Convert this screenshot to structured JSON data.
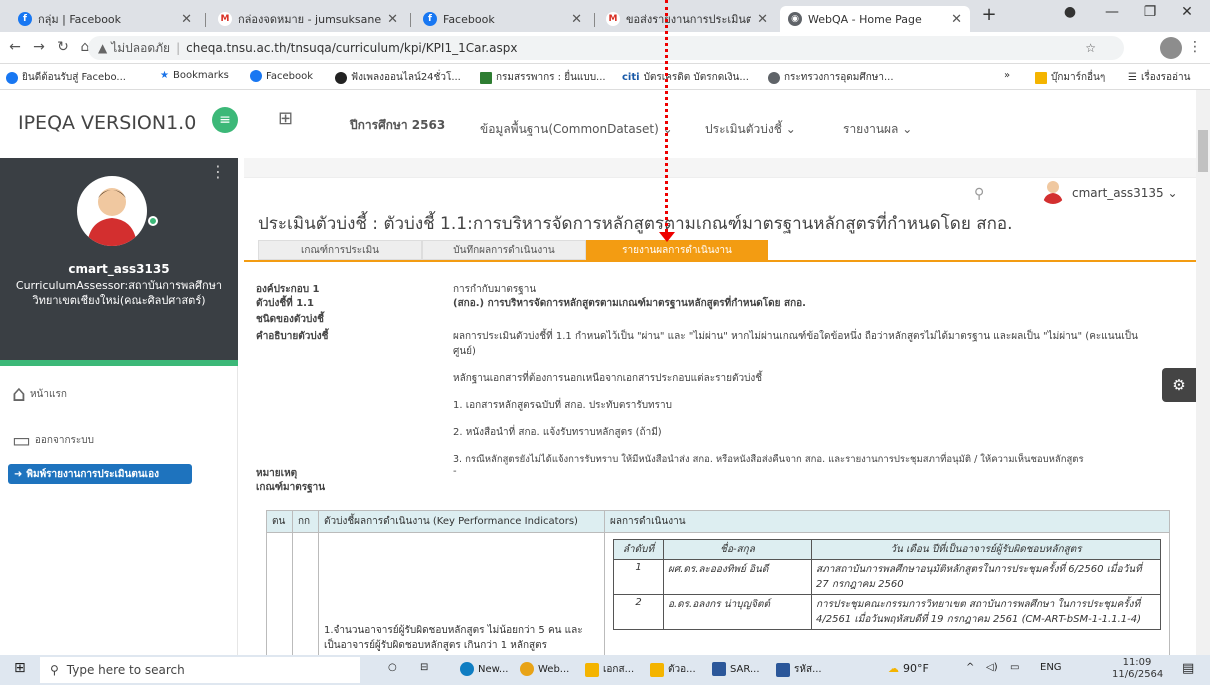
{
  "browser": {
    "tabs": [
      {
        "label": "กลุ่ม | Facebook",
        "icon": "facebook-icon",
        "color": "#1877f2"
      },
      {
        "label": "กล่องจดหมาย - jumsuksane",
        "icon": "gmail-icon",
        "color": "#d93025"
      },
      {
        "label": "Facebook",
        "icon": "facebook-icon",
        "color": "#1877f2"
      },
      {
        "label": "ขอส่งรายงานการประเมินตนเอง",
        "icon": "gmail-icon",
        "color": "#d93025"
      },
      {
        "label": "WebQA - Home Page",
        "icon": "globe-icon",
        "color": "#5f6368"
      }
    ],
    "new_tab": "+",
    "url_warning": "ไม่ปลอดภัย",
    "url": "cheqa.tnsu.ac.th/tnsuqa/curriculum/kpi/KPI1_1Car.aspx",
    "bookmarks": [
      "ยินดีต้อนรับสู่ Facebo...",
      "Bookmarks",
      "Facebook",
      "ฟังเพลงออนไลน์24ชั่วโ...",
      "กรมสรรพากร : ยื่นแบบ...",
      "บัตรเครดิต บัตรกดเงิน...",
      "กระทรวงการอุดมศึกษา..."
    ],
    "bookmark_more": "»",
    "bookmark_others": "บุ๊กมาร์กอื่นๆ",
    "reading_list": "เรื่องรออ่าน"
  },
  "topnav": {
    "brand": "IPEQA VERSION1.0",
    "year": "ปีการศึกษา 2563",
    "menu": [
      "ข้อมูลพื้นฐาน(CommonDataset)",
      "ประเมินตัวบ่งชี้",
      "รายงานผล"
    ]
  },
  "user": {
    "name": "cmart_ass3135",
    "role": "CurriculumAssessor:สถาบันการพลศึกษา วิทยาเขตเชียงใหม่(คณะศิลปศาสตร์)",
    "top_name": "cmart_ass3135"
  },
  "sidebar": {
    "home": "หน้าแรก",
    "logout": "ออกจากระบบ",
    "print": "พิมพ์รายงานการประเมินตนเอง"
  },
  "main": {
    "title": "ประเมินตัวบ่งชี้ : ตัวบ่งชี้ 1.1:การบริหารจัดการหลักสูตรตามเกณฑ์มาตรฐานหลักสูตรที่กำหนดโดย สกอ.",
    "tabs": [
      "เกณฑ์การประเมิน",
      "บันทึกผลการดำเนินงาน",
      "รายงานผลการดำเนินงาน"
    ],
    "fields": {
      "component_label": "องค์ประกอบ 1",
      "component_value": "การกำกับมาตรฐาน",
      "indicator_label": "ตัวบ่งชี้ที่ 1.1",
      "indicator_value": "(สกอ.) การบริหารจัดการหลักสูตรตามเกณฑ์มาตรฐานหลักสูตรที่กำหนดโดย สกอ.",
      "type_label": "ชนิดของตัวบ่งชี้",
      "desc_label": "คำอธิบายตัวบ่งชี้",
      "desc_value": "ผลการประเมินตัวบ่งชี้ที่ 1.1 กำหนดไว้เป็น \"ผ่าน\" และ \"ไม่ผ่าน\" หากไม่ผ่านเกณฑ์ข้อใดข้อหนึ่ง ถือว่าหลักสูตรไม่ได้มาตรฐาน และผลเป็น \"ไม่ผ่าน\" (คะแนนเป็น ศูนย์)",
      "evidence_intro": "หลักฐานเอกสารที่ต้องการนอกเหนือจากเอกสารประกอบแต่ละรายตัวบ่งชี้",
      "evidence": [
        "1. เอกสารหลักสูตรฉบับที่ สกอ. ประทับตรารับทราบ",
        "2. หนังสือนำที่ สกอ. แจ้งรับทราบหลักสูตร (ถ้ามี)",
        "3. กรณีหลักสูตรยังไม่ได้แจ้งการรับทราบ ให้มีหนังสือนำส่ง สกอ. หรือหนังสือส่งคืนจาก สกอ. และรายงานการประชุมสภาที่อนุมัติ / ให้ความเห็นชอบหลักสูตร"
      ],
      "note_label": "หมายเหตุ",
      "note_value": "-",
      "criteria_label": "เกณฑ์มาตรฐาน"
    },
    "table": {
      "headers": [
        "ตน",
        "กก",
        "ตัวบ่งชี้ผลการดำเนินงาน (Key Performance Indicators)",
        "ผลการดำเนินงาน"
      ],
      "row_kpi": "1.จำนวนอาจารย์ผู้รับผิดชอบหลักสูตร ไม่น้อยกว่า 5 คน และเป็นอาจารย์ผู้รับผิดชอบหลักสูตร เกินกว่า 1 หลักสูตร",
      "inner_headers": [
        "ลำดับที่",
        "ชื่อ-สกุล",
        "วัน เดือน ปีที่เป็นอาจารย์ผู้รับผิดชอบหลักสูตร"
      ],
      "inner_rows": [
        {
          "no": "1",
          "name": "ผศ.ดร.ละอองทิพย์ อินดี",
          "date": "สภาสถาบันการพลศึกษาอนุมัติหลักสูตรในการประชุมครั้งที่ 6/2560 เมื่อวันที่ 27 กรกฎาคม 2560"
        },
        {
          "no": "2",
          "name": "อ.ดร.อลงกร น่าบุญจิตต์",
          "date": "การประชุมคณะกรรมการวิทยาเขต สถาบันการพลศึกษา ในการประชุมครั้งที่ 4/2561 เมื่อวันพฤหัสบดีที่ 19 กรกฎาคม 2561 (CM-ART-bSM-1-1.1.1-4)"
        }
      ]
    }
  },
  "taskbar": {
    "search": "Type here to search",
    "apps": [
      "New...",
      "Web...",
      "เอกส...",
      "ตัวอ...",
      "SAR...",
      "รหัส..."
    ],
    "weather": "90°F",
    "lang": "ENG",
    "time": "11:09",
    "date": "11/6/2564"
  }
}
